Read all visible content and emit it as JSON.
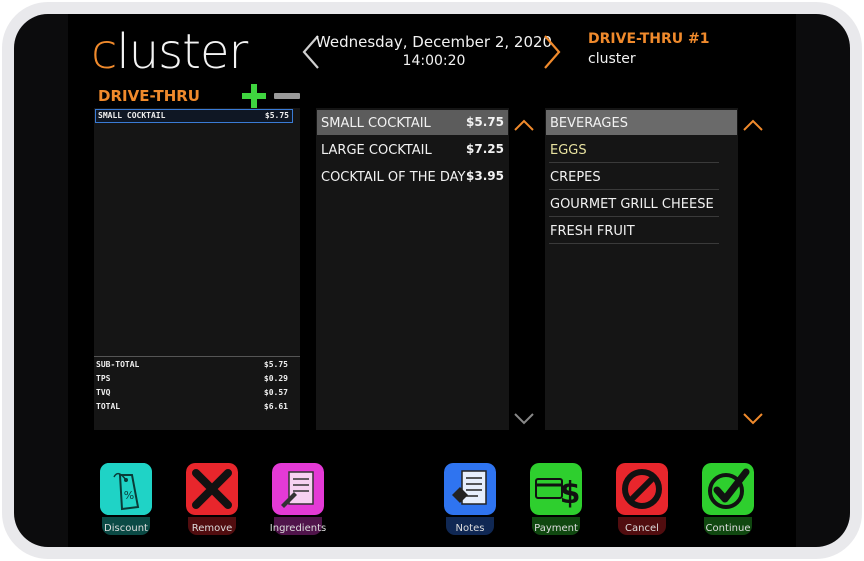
{
  "header": {
    "logo_c": "c",
    "logo_rest": "luster",
    "date": "Wednesday, December 2, 2020",
    "time": "14:00:20",
    "terminal": "DRIVE-THRU #1",
    "user": "cluster"
  },
  "order": {
    "title": "DRIVE-THRU",
    "lines": [
      {
        "name": "SMALL COCKTAIL",
        "price": "$5.75"
      }
    ],
    "totals": [
      {
        "label": "SUB-TOTAL",
        "value": "$5.75"
      },
      {
        "label": "TPS",
        "value": "$0.29"
      },
      {
        "label": "TVQ",
        "value": "$0.57"
      },
      {
        "label": "TOTAL",
        "value": "$6.61"
      }
    ]
  },
  "items": [
    {
      "name": "SMALL COCKTAIL",
      "price": "$5.75"
    },
    {
      "name": "LARGE COCKTAIL",
      "price": "$7.25"
    },
    {
      "name": "COCKTAIL OF THE DAY",
      "price": "$3.95"
    }
  ],
  "categories": [
    {
      "name": "BEVERAGES"
    },
    {
      "name": "EGGS"
    },
    {
      "name": "CREPES"
    },
    {
      "name": "GOURMET GRILL CHEESE"
    },
    {
      "name": "FRESH FRUIT"
    }
  ],
  "buttons": {
    "discount": "Discount",
    "remove": "Remove",
    "ingredients": "Ingredients",
    "notes": "Notes",
    "payment": "Payment",
    "cancel": "Cancel",
    "continue": "Continue"
  },
  "colors": {
    "accent": "#f08a2c",
    "discount": "#1fd3c6",
    "remove": "#e8262c",
    "ingredients": "#e43ad6",
    "notes": "#2f74f0",
    "payment": "#2ecf2e",
    "cancel": "#e8262c",
    "continue": "#2ecf2e",
    "eggs_text": "#e8e2a0"
  },
  "icons": {
    "prev": "chevron-left-icon",
    "next": "chevron-right-icon",
    "add": "plus-icon",
    "subtract": "minus-icon"
  }
}
